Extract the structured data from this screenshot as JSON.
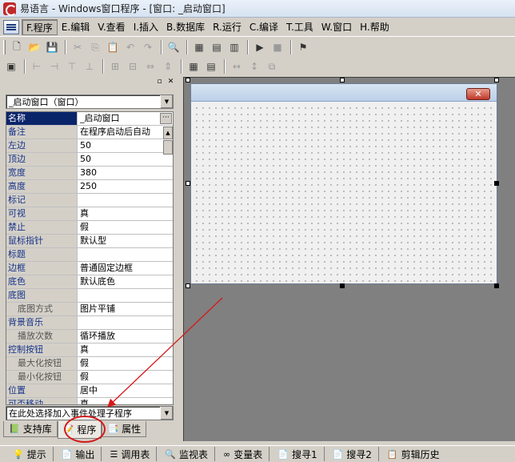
{
  "window": {
    "title": "易语言 - Windows窗口程序 - [窗口: _启动窗口]"
  },
  "menu": [
    "F.程序",
    "E.编辑",
    "V.查看",
    "I.插入",
    "B.数据库",
    "R.运行",
    "C.编译",
    "T.工具",
    "W.窗口",
    "H.帮助"
  ],
  "object_combo": {
    "value": "_启动窗口（窗口）"
  },
  "properties": [
    {
      "name": "名称",
      "value": "_启动窗口",
      "selected": true
    },
    {
      "name": "备注",
      "value": "在程序启动后自动"
    },
    {
      "name": "左边",
      "value": "50"
    },
    {
      "name": "顶边",
      "value": "50"
    },
    {
      "name": "宽度",
      "value": "380"
    },
    {
      "name": "高度",
      "value": "250"
    },
    {
      "name": "标记",
      "value": ""
    },
    {
      "name": "可视",
      "value": "真"
    },
    {
      "name": "禁止",
      "value": "假"
    },
    {
      "name": "鼠标指针",
      "value": "默认型"
    },
    {
      "name": "标题",
      "value": ""
    },
    {
      "name": "边框",
      "value": "普通固定边框"
    },
    {
      "name": "底色",
      "value": "默认底色"
    },
    {
      "name": "底图",
      "value": ""
    },
    {
      "name": "底图方式",
      "value": "图片平铺",
      "sub": true
    },
    {
      "name": "背景音乐",
      "value": ""
    },
    {
      "name": "播放次数",
      "value": "循环播放",
      "sub": true
    },
    {
      "name": "控制按钮",
      "value": "真"
    },
    {
      "name": "最大化按钮",
      "value": "假",
      "sub": true
    },
    {
      "name": "最小化按钮",
      "value": "假",
      "sub": true
    },
    {
      "name": "位置",
      "value": "居中"
    },
    {
      "name": "可否移动",
      "value": "真"
    }
  ],
  "event_combo": {
    "value": "在此处选择加入事件处理子程序"
  },
  "tabs": [
    {
      "label": "支持库",
      "icon": "library-icon"
    },
    {
      "label": "程序",
      "icon": "program-icon",
      "active": true
    },
    {
      "label": "属性",
      "icon": "property-icon"
    }
  ],
  "status": [
    {
      "label": "提示",
      "icon": "tip-icon"
    },
    {
      "label": "输出",
      "icon": "output-icon"
    },
    {
      "label": "调用表",
      "icon": "callstack-icon"
    },
    {
      "label": "监视表",
      "icon": "watch-icon"
    },
    {
      "label": "变量表",
      "icon": "variable-icon"
    },
    {
      "label": "搜寻1",
      "icon": "search1-icon"
    },
    {
      "label": "搜寻2",
      "icon": "search2-icon"
    },
    {
      "label": "剪辑历史",
      "icon": "clipboard-history-icon"
    }
  ],
  "form_close": "✕",
  "annotation_color": "#d41919"
}
